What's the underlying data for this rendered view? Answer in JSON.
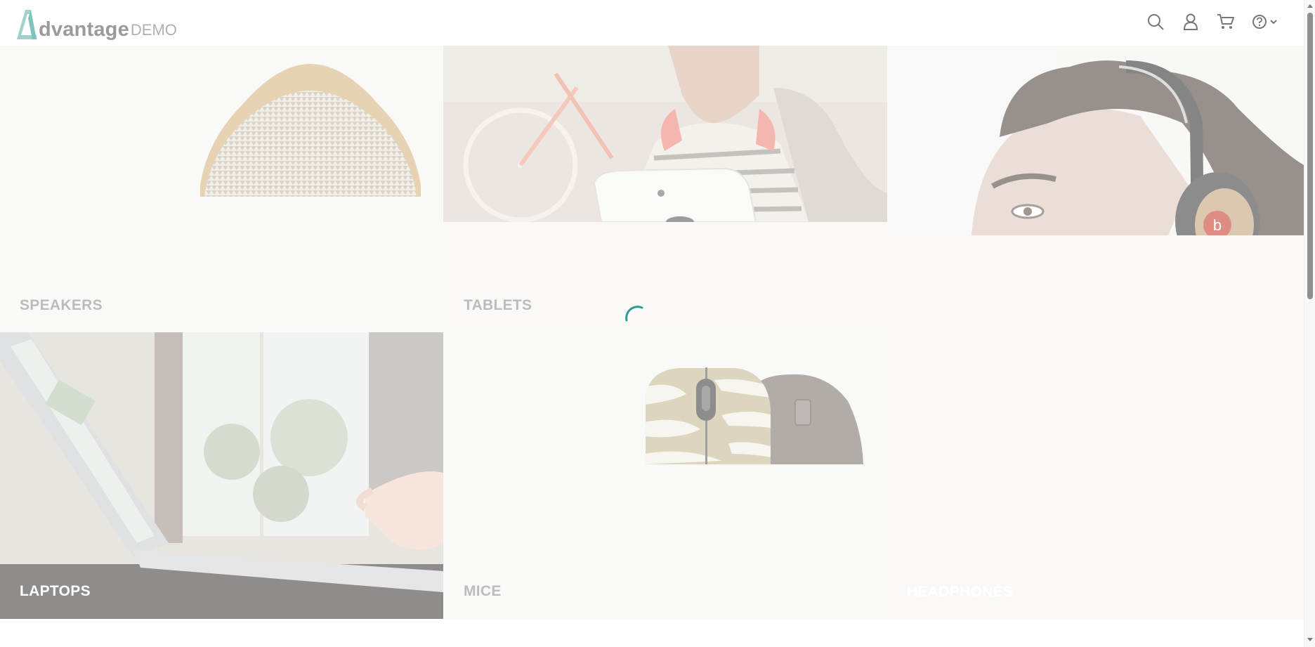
{
  "header": {
    "logo_word": "dvantage",
    "logo_demo": "DEMO",
    "icons": [
      "search-icon",
      "user-icon",
      "cart-icon",
      "help-icon",
      "chevron-down-icon"
    ]
  },
  "categories": {
    "speakers": "SPEAKERS",
    "tablets": "TABLETS",
    "headphones": "HEADPHONES",
    "laptops": "LAPTOPS",
    "mice": "MICE"
  },
  "colors": {
    "brand": "#7fc3be",
    "label": "#8c8c8c",
    "spinner": "#2c9a96"
  }
}
